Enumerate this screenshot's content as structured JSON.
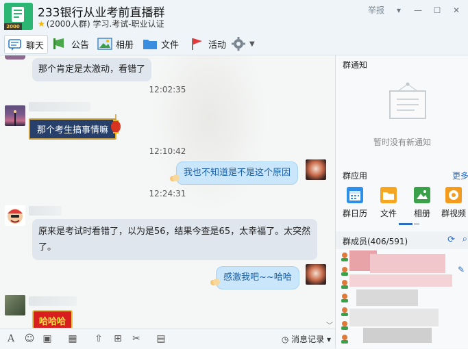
{
  "header": {
    "group_name": "233银行从业考前直播群",
    "group_sub": "(2000人群) 学习.考试-职业认证",
    "avatar_badge": "2000",
    "report_label": "举报"
  },
  "toolbar": {
    "chat": "聊天",
    "notice": "公告",
    "album": "相册",
    "files": "文件",
    "activity": "活动"
  },
  "chat": {
    "messages": [
      {
        "text": "那个肯定是太激动，看错了"
      },
      {
        "time": "12:02:35"
      },
      {
        "text": "那个考生搞事情嘛"
      },
      {
        "time": "12:10:42"
      },
      {
        "text": "我也不知道是不是这个原因"
      },
      {
        "time": "12:24:31"
      },
      {
        "text": "原来是考试时看错了，以为是56，结果今查是65，太幸福了。太突然了。"
      },
      {
        "text": "感激我吧~~哈哈"
      },
      {
        "text": "哈哈哈"
      }
    ]
  },
  "input_bar": {
    "history_label": "消息记录"
  },
  "right_panel": {
    "notice_title": "群通知",
    "notice_empty": "暂时没有新通知",
    "apps_title": "群应用",
    "apps_more": "更多",
    "apps": [
      "群日历",
      "文件",
      "相册",
      "群视频"
    ],
    "members_title": "群成员(406/591)"
  },
  "colors": {
    "accent": "#2bb673",
    "link": "#2b6bc2",
    "bubble_self": "#c9e6fb",
    "bubble_other": "#dfe6ee"
  }
}
